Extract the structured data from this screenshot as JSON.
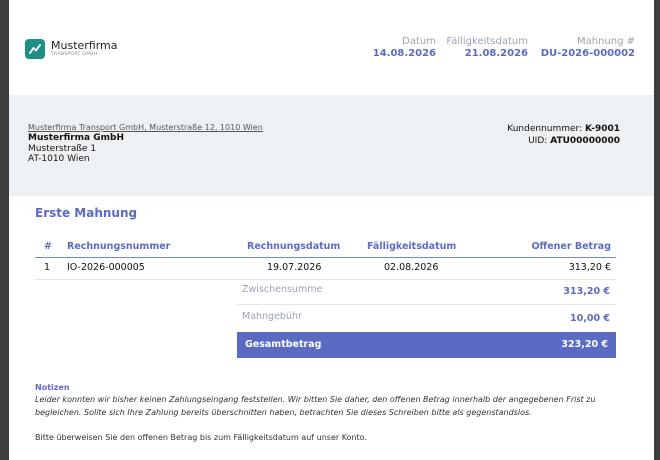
{
  "company": {
    "name": "Musterfirma",
    "tagline": "TRANSPORT GMBH",
    "brand_color": "#1f8f86"
  },
  "meta": {
    "date_label": "Datum",
    "date_value": "14.08.2026",
    "due_label": "Fälligkeitsdatum",
    "due_value": "21.08.2026",
    "number_label": "Mahnung #",
    "number_value": "DU-2026-000002"
  },
  "address": {
    "sender_line": "Musterfirma Transport GmbH, Musterstraße 12, 1010 Wien",
    "recipient_company": "Musterfirma GmbH",
    "street": "Musterstraße 1",
    "city": "AT-1010 Wien"
  },
  "customer": {
    "number_label": "Kundennummer:",
    "number_value": "K-9001",
    "uid_label": "UID:",
    "uid_value": "ATU00000000"
  },
  "document": {
    "title": "Erste Mahnung",
    "accent": "#5b6bc4"
  },
  "table": {
    "headers": [
      "#",
      "Rechnungsnummer",
      "Rechnungsdatum",
      "Fälligkeitsdatum",
      "Offener Betrag"
    ],
    "rows": [
      [
        "1",
        "IO-2026-000005",
        "19.07.2026",
        "02.08.2026",
        "313,20 €"
      ]
    ]
  },
  "summary": {
    "subtotal_label": "Zwischensumme",
    "subtotal_value": "313,20 €",
    "fee_label": "Mahngebühr",
    "fee_value": "10,00 €",
    "total_label": "Gesamtbetrag",
    "total_value": "323,20 €"
  },
  "notes": {
    "heading": "Notizen",
    "text": "Leider konnten wir bisher keinen Zahlungseingang feststellen. Wir bitten Sie daher, den offenen Betrag innerhalb der angegebenen Frist zu begleichen. Solite sich Ihre Zahlung bereits überschnitten haben, betrachten Sie dieses Schreiben bitte als gegenstandslos.",
    "footer": "Bitte überweisen Sie den offenen Betrag bis zum Fälligkeitsdatum auf unser Konto."
  }
}
